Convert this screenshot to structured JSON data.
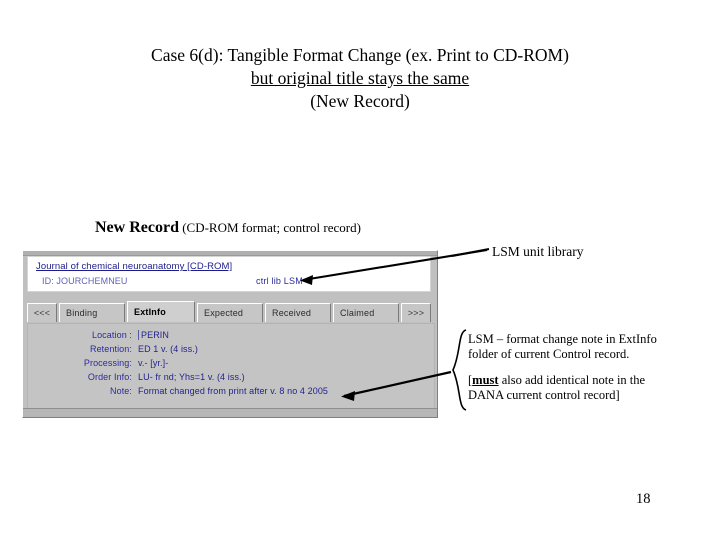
{
  "slide": {
    "title_lines": [
      "Case 6(d):  Tangible Format Change (ex. Print to CD-ROM)",
      "but original title stays the same",
      "(New Record)"
    ],
    "page_number": "18"
  },
  "caption": {
    "strong": "New Record",
    "paren": " (CD-ROM format; control record)"
  },
  "screenshot": {
    "record_title": "Journal of chemical neuroanatomy [CD-ROM]",
    "record_subline": "ID: JOURCHEMNEU",
    "record_ctrl": "ctrl lib LSM",
    "tabs": [
      {
        "label": "<<<",
        "active": false,
        "kind": "nav"
      },
      {
        "label": "Binding",
        "active": false,
        "kind": "normal"
      },
      {
        "label": "ExtInfo",
        "active": true,
        "kind": "normal"
      },
      {
        "label": "Expected",
        "active": false,
        "kind": "normal"
      },
      {
        "label": "Received",
        "active": false,
        "kind": "normal"
      },
      {
        "label": "Claimed",
        "active": false,
        "kind": "normal"
      },
      {
        "label": ">>>",
        "active": false,
        "kind": "nav"
      }
    ],
    "fields": [
      {
        "label": "Location :",
        "value": "PERIN"
      },
      {
        "label": "Retention:",
        "value": "ED 1 v. (4 iss.)"
      },
      {
        "label": "Processing:",
        "value": "v.- [yr.]-"
      },
      {
        "label": "Order Info:",
        "value": "LU- fr nd; Yhs=1 v. (4 iss.)"
      },
      {
        "label": "Note:",
        "value": "Format changed from print after v. 8 no 4 2005"
      }
    ]
  },
  "annotations": {
    "lsm_unit_library": "LSM unit library",
    "note_line_1": "LSM – format change note in ExtInfo",
    "note_line_2": "folder of current Control record.",
    "must_bracket_open": "[",
    "must_word": "must",
    "must_rest": " also add identical note in the",
    "must_line_2": "DANA current control record]"
  },
  "colors": {
    "window_face": "#c0c0c0",
    "field_text": "#22228f",
    "text": "#000000"
  }
}
